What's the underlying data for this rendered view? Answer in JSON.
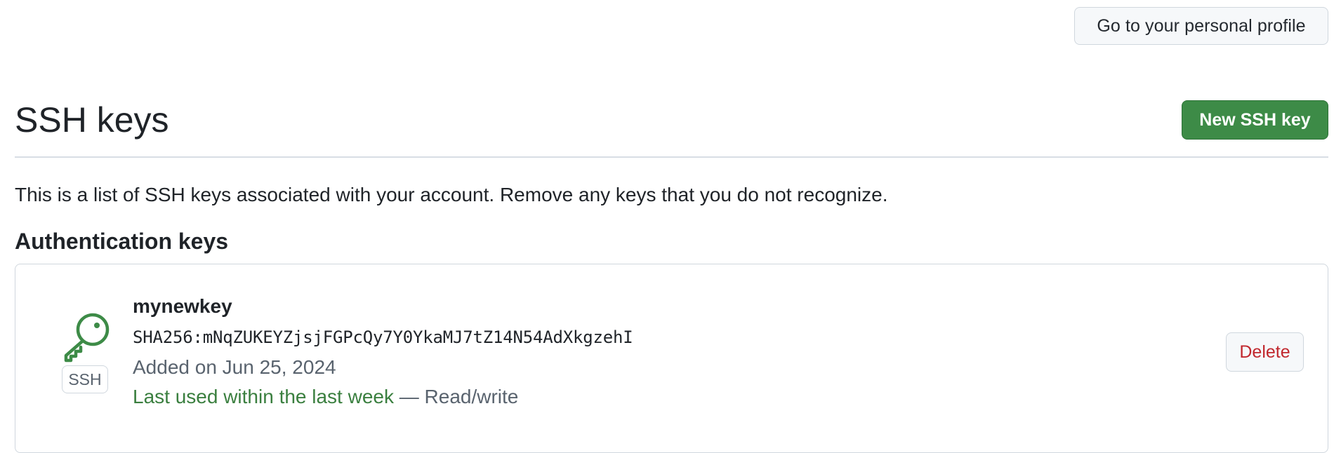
{
  "header": {
    "profile_button_label": "Go to your personal profile"
  },
  "page": {
    "title": "SSH keys",
    "new_key_button_label": "New SSH key",
    "description": "This is a list of SSH keys associated with your account. Remove any keys that you do not recognize."
  },
  "auth_keys": {
    "heading": "Authentication keys",
    "items": [
      {
        "icon": "key-icon",
        "type_label": "SSH",
        "name": "mynewkey",
        "fingerprint": "SHA256:mNqZUKEYZjsjFGPcQy7Y0YkaMJ7tZ14N54AdXkgzehI",
        "added": "Added on Jun 25, 2024",
        "last_used": "Last used within the last week",
        "separator": " — ",
        "access": "Read/write",
        "delete_label": "Delete"
      }
    ]
  },
  "colors": {
    "accent_green": "#3d8b47",
    "danger_red": "#c1272d",
    "muted_text": "#59636e",
    "border": "#d0d7de"
  }
}
